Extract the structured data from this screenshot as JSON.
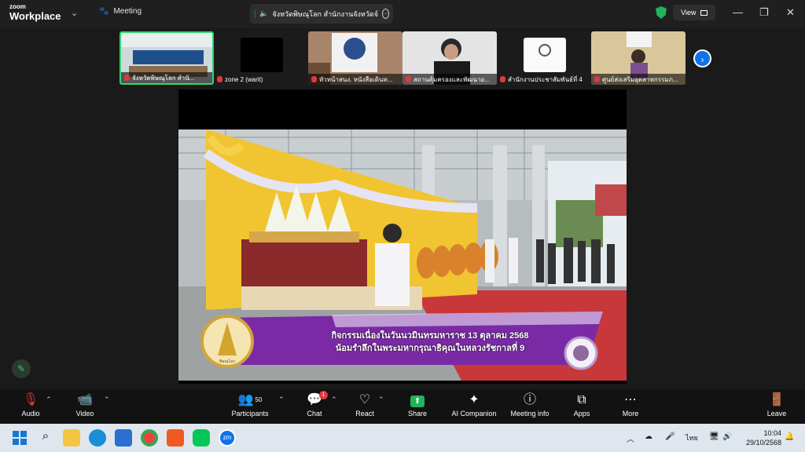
{
  "app": {
    "brand_small": "zoom",
    "brand_large": "Workplace"
  },
  "tabs": {
    "meeting_label": "Meeting",
    "active_label": "จังหวัดพิษณุโลก สำนักงานจังหวัดจ์"
  },
  "header": {
    "view_label": "View"
  },
  "participants_strip": [
    {
      "label": "จังหวัดพิษณุโลก สำนั..."
    },
    {
      "label": "zone 2 (warit)"
    },
    {
      "label": "หัวหน้าสนง. หนังสือเดินท..."
    },
    {
      "label": "สถานคุ้มครองและพัฒนาอ..."
    },
    {
      "label": "สำนักงานประชาสัมพันธ์ที่ 4"
    },
    {
      "label": "ศูนย์ส่งเสริมอุตสาหกรรมภ..."
    }
  ],
  "video": {
    "banner_line1": "กิจกรรมเนื่องในวันนวมินทรมหาราช 13 ตุลาคม 2568",
    "banner_line2": "น้อมรำลึกในพระมหากรุณาธิคุณในหลวงรัชกาลที่ 9",
    "seal_left_text": "พิษณุโลก"
  },
  "toolbar": {
    "audio": "Audio",
    "video": "Video",
    "participants": "Participants",
    "participants_count": "50",
    "chat": "Chat",
    "chat_badge": "1",
    "react": "React",
    "share": "Share",
    "ai": "AI Companion",
    "info": "Meeting info",
    "apps": "Apps",
    "more": "More",
    "leave": "Leave"
  },
  "taskbar": {
    "language": "ไทย",
    "time": "10:04",
    "date": "29/10/2568"
  },
  "colors": {
    "accent": "#0e72ed",
    "share_green": "#22b35b",
    "leave_red": "#e0393e",
    "banner_purple": "#7b2aa6"
  }
}
